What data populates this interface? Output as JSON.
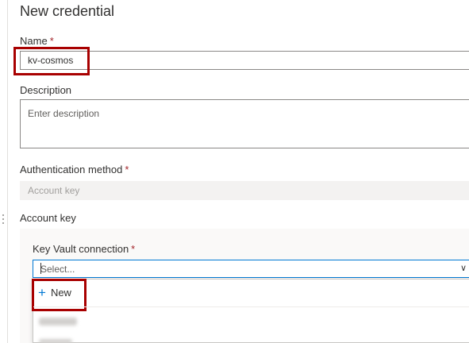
{
  "page": {
    "title": "New credential"
  },
  "form": {
    "name": {
      "label": "Name",
      "required": "*",
      "value": "kv-cosmos"
    },
    "description": {
      "label": "Description",
      "placeholder": "Enter description"
    },
    "auth_method": {
      "label": "Authentication method",
      "required": "*",
      "value": "Account key"
    },
    "account_key": {
      "label": "Account key",
      "key_vault_connection": {
        "label": "Key Vault connection",
        "required": "*",
        "placeholder": "Select...",
        "chevron_icon": "chevron-down-icon"
      },
      "dropdown": {
        "new_label": "New",
        "new_icon": "plus-icon"
      }
    }
  },
  "colors": {
    "accent": "#0078d4",
    "required": "#a4262c",
    "highlight": "#a80000"
  }
}
